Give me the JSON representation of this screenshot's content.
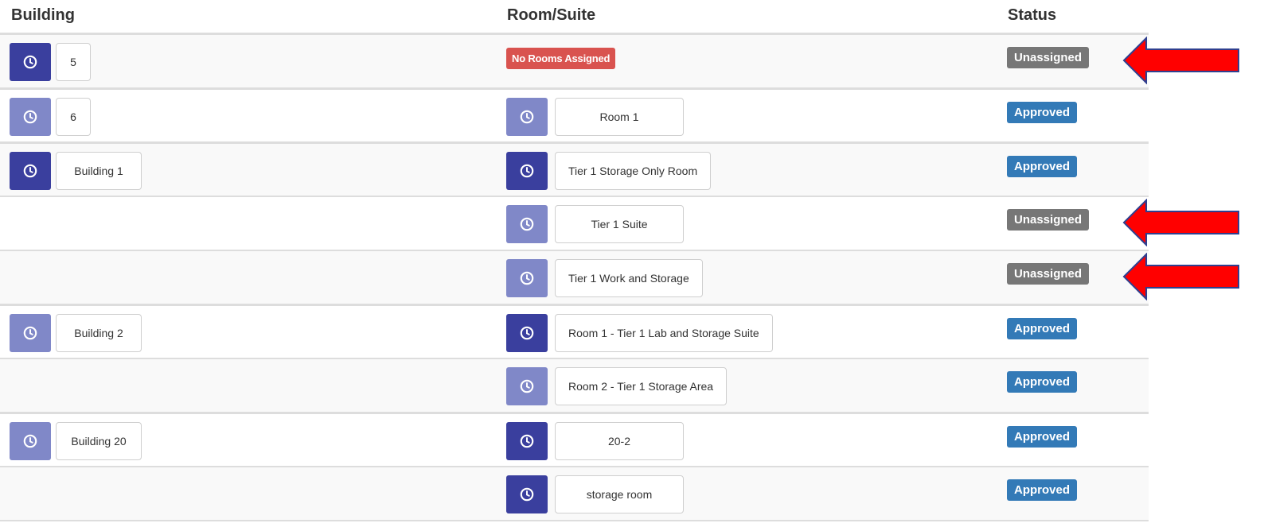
{
  "columns": {
    "building": "Building",
    "room": "Room/Suite",
    "status": "Status"
  },
  "status_colors": {
    "Unassigned": "#777777",
    "Approved": "#337ab7",
    "no_rooms": "#d9534f"
  },
  "icon": "clock-icon",
  "rows": [
    {
      "building": "5",
      "building_icon": "dark",
      "room": "",
      "no_rooms_label": "No Rooms Assigned",
      "status": "Unassigned",
      "arrow": true
    },
    {
      "building": "6",
      "building_icon": "light",
      "room": "Room 1",
      "room_icon": "light",
      "status": "Approved"
    },
    {
      "building": "Building 1",
      "building_icon": "dark",
      "room": "Tier 1 Storage Only Room",
      "room_icon": "dark",
      "status": "Approved"
    },
    {
      "building": "",
      "room": "Tier 1 Suite",
      "room_icon": "light",
      "status": "Unassigned",
      "arrow": true
    },
    {
      "building": "",
      "room": "Tier 1 Work and Storage",
      "room_icon": "light",
      "status": "Unassigned",
      "arrow": true
    },
    {
      "building": "Building 2",
      "building_icon": "light",
      "room": "Room 1 - Tier 1 Lab and Storage Suite",
      "room_icon": "dark",
      "status": "Approved"
    },
    {
      "building": "",
      "room": "Room 2 - Tier 1 Storage Area",
      "room_icon": "light",
      "status": "Approved"
    },
    {
      "building": "Building 20",
      "building_icon": "light",
      "room": "20-2",
      "room_icon": "dark",
      "status": "Approved"
    },
    {
      "building": "",
      "room": "storage room",
      "room_icon": "dark",
      "status": "Approved"
    }
  ]
}
